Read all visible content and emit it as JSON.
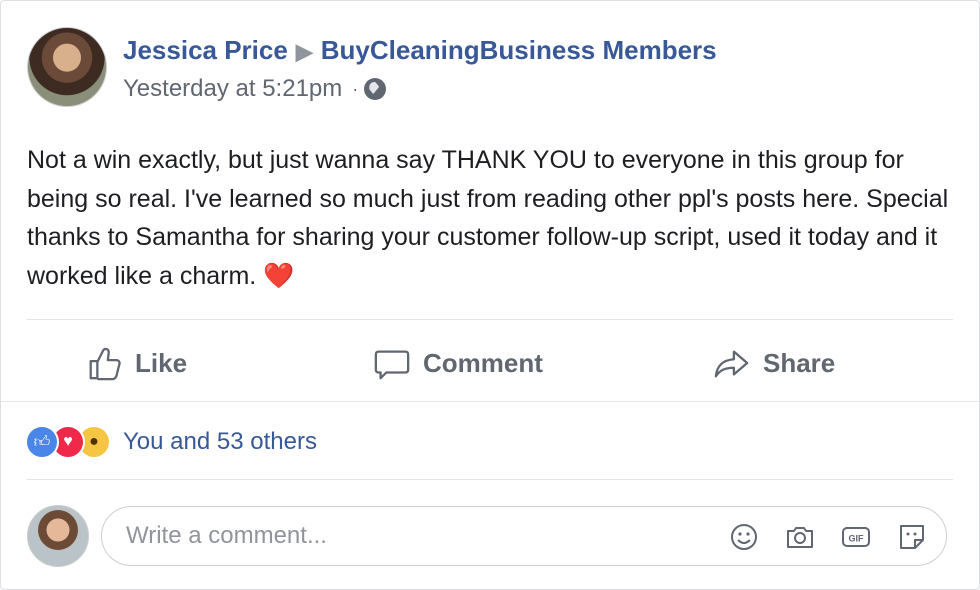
{
  "post": {
    "author": "Jessica Price",
    "separator": "▶",
    "group": "BuyCleaningBusiness Members",
    "timestamp": "Yesterday at 5:21pm",
    "dot": "·",
    "privacy_icon": "globe-icon",
    "text": "Not a win exactly, but just wanna say THANK YOU to everyone in this group for being so real. I've learned so much just from reading other ppl's posts here. Special thanks to Samantha for sharing your customer follow-up script, used it today and it worked like a charm. ❤️"
  },
  "actions": {
    "like": "Like",
    "comment": "Comment",
    "share": "Share"
  },
  "reactions": {
    "types": [
      "like",
      "love",
      "wow"
    ],
    "summary": "You and 53 others"
  },
  "composer": {
    "placeholder": "Write a comment...",
    "tools": [
      "emoji-icon",
      "camera-icon",
      "gif-icon",
      "sticker-icon"
    ]
  },
  "colors": {
    "link": "#385898",
    "muted": "#606770",
    "like": "#4a86e8",
    "love": "#f0284a",
    "wow": "#f7c544"
  }
}
